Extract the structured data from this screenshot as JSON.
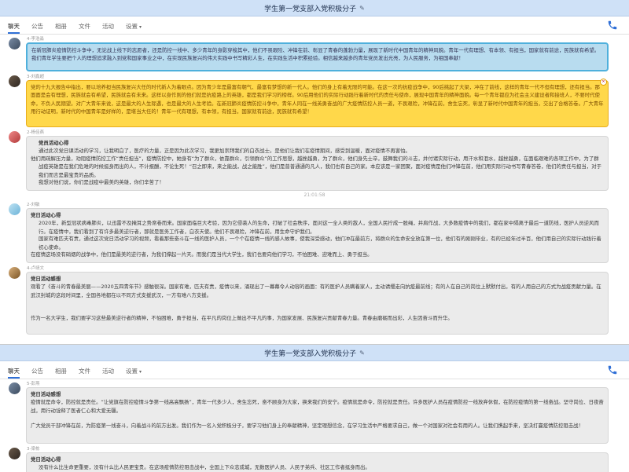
{
  "top": {
    "title": "学生第一党支部入党积极分子",
    "tabs": [
      "聊天",
      "公告",
      "相册",
      "文件",
      "活动",
      "设置"
    ],
    "messages": [
      {
        "sender": "4-李浩淼",
        "style": "blue",
        "lines": [
          "在新冠肺炎疫情防控斗争中，无论战上线下的志愿者，还是防控一线中、多少青年的身影穿梭其中，他们不畏艰险、冲锋在前、彰显了青春的蓬勃力量，展现了新时代中国青年的精神风貌。青年一代有理想、有本领、有担当，国家就有前途，民族就有希望。我们青年学生要把个人的理想追求融入到党和国家事业之中，在实现民族复兴的伟大实践中书写精彩人生，在实践生活中积累经验。相信越来越多的青年党员发出光亮，为人民服务，为祖国奉献！"
        ]
      },
      {
        "sender": "3-刘鑫超",
        "style": "yellow",
        "lines": [
          "党的十九大报告中指出，要以培养担当民族复兴大任的时代新人为着眼点。因为青少年是最富有朝气、最富有梦想的新一代人。他们的身上有着无限的可能。在这一次的抗疫战争中，90后挑起了大梁，冲在了前线，这样的青年一代不但有理想，还有担当。那面面是会有理想，民族就会有希望，民族就会有未来。这样以身作则的他们就是抗疫路上的英雄，都是我们学习的榜样。90后用他们的实际行动践行着新时代的责任与使命，展现中国青年的精神面貌。每一个青年都应为社会主义建设者和接班人，不要时代使命，不负人民期望。对广大青年来说，这是最大的人生际遇，也是最大的人生考验。在新冠肺炎疫情防控斗争中，青年人同在一线英勇奋战的广大疫情防控人员一道，不畏艰险，冲锋在前，舍生忘死，彰显了新时代中国青年的担当，交出了合格答卷。广大青年用行动证明，新时代的中国青年是好样的，是堪当大任的！青年一代有理想，有本领，有担当，国家就有前途，民族就有希望！"
        ]
      },
      {
        "sender": "2-杨佳燕",
        "style": "gray",
        "title": "党员活动心得",
        "lines": [
          "通过此次党日课活动的学习，让我明白了，医疗的力量，正是因为此次学习，我更加崇拜我们的白衣战士。是他们让我们在疫情期间，感受到温暖，面对疫情不再害怕。",
          "他们用疏解压力量，劝阻疫情防控工作“责任担当”，疫情防控中，她身有“为了群众，依靠群众，引领群众”的工作思想，越挫越勇，为了群众，他们身先士卒，鼓舞我们的斗志，并付诸实际行动，用汗水和泪水，越挫越勇，在面临艰难的各项工作中，为了群众，他们义无反顾，冲锋一线，为群众所想为群众解决困难，坚持着最广大群众的利益。",
          "战疫英雄是在我们危难的时候挺身而出的人，不计报酬，不论生死！“召之即来，来之能战，战之能胜”，他们是普普通通的凡人，我们也有自己的家。本应该是一家团聚，面对疫情是他们冲锋在前，他们用实际行动书写青春答卷，他们的责任与担当，对于我们而言是最宝贵的品质。",
          "我想对他们说，你们是战疫中最美的英雄，你们辛苦了！"
        ]
      },
      {
        "time": "21:01:58"
      },
      {
        "sender": "2-刘敏",
        "style": "gray",
        "title": "党日活动心得",
        "lines": [
          "2020年，新型冠状病毒肺炎，以迅雷不及掩耳之势席卷而来。国家面临巨大考验，因为它侵袭人的生命，打破了社会秩序，面对这一全人类的敌人，全国人民拧成一股绳，并肩作战，大多数疫情中的我们，都在家中隔离于最后一道防线，医护人员逆风而行。在疫情中，我们看到了有许多最美逆行者，那就是医务工作者，白衣天使。他们不畏艰险，冲锋在前，用生命守护我们。",
          "国家有难匹夫有责，通过这次党日活动学习的视频，看着那些奋斗在一线的医护人员，一个个在疫情一线的感人故事，使我深受感动，他们冲在最前方，将群众的生命安全放在第一位，他们有的刚刚毕业，有的已经年过半百，他们用自己的实际行动践行着初心使命。",
          "在疫情这场没有硝烟的战争中，他们是最美的逆行者，为我们撑起一片天。而我们是当代大学生，我们也要向他们学习，不怕困难、迎难而上、勇于担当。"
        ]
      },
      {
        "sender": "4-卢靖文",
        "style": "gray",
        "title": "党日活动感想",
        "lines": [
          "观看了《奋斗的青春最美丽——2020五四青年节》感触很深。国家有难，匹夫有责，疫情以来，涌现出了一幕幕令人动容的画面：有的医护人员瞒着家人，主动请缨走向抗疫最前线；有的人在自己的岗位上默默付出，有的人用自己的方式为战疫贡献力量。在武汉封城的这段时间里，全国各地都在以不同方式支援武汉，一方有难八方支援。",
          "作为一名大学生，我们要学习这些最美逆行者的精神，不怕困难，勇于担当，在平凡的岗位上做出不平凡的事，为国家发展、民族复兴贡献青春力量。青春由磨砺而出彩，人生因奋斗而升华。"
        ]
      }
    ]
  },
  "bottom": {
    "title": "学生第一党支部入党积极分子",
    "tabs": [
      "聊天",
      "公告",
      "相册",
      "文件",
      "活动",
      "设置"
    ],
    "messages": [
      {
        "sender": "5-彭燕",
        "style": "gray",
        "title": "党日活动感想",
        "lines": [
          "疫情就是命令，防控就是责任。“让党旗在防控疫情斗争第一线高高飘扬”，青年一代多少人，舍生忘死，奋不顾身为大家，换来我们的安宁。疫情就是命令，防控就是责任。许多医护人员在疫情防控一线放弃休假，在防控疫情的第一线奋战。坚守岗位、日夜奋战，用行动诠释了医者仁心和大爱无疆。",
          "广大党员干部冲锋在前，为防疫第一线奋斗，向着战斗的前方出发。我们作为一名入党积极分子，要学习他们身上的奉献精神，坚定理想信念，在学习生活中严格要求自己，做一个对国家对社会有用的人。让我们携起手来，坚决打赢疫情防控阻击战！"
        ]
      },
      {
        "sender": "3-梁栋",
        "style": "gray",
        "title": "党日活动心得",
        "lines": [
          "没有什么比生命更重要，没有什么比人民更宝贵。在这场疫情防控阻击战中，全国上下众志成城，无数医护人员、人民子弟兵、社区工作者挺身而出。"
        ]
      }
    ]
  }
}
